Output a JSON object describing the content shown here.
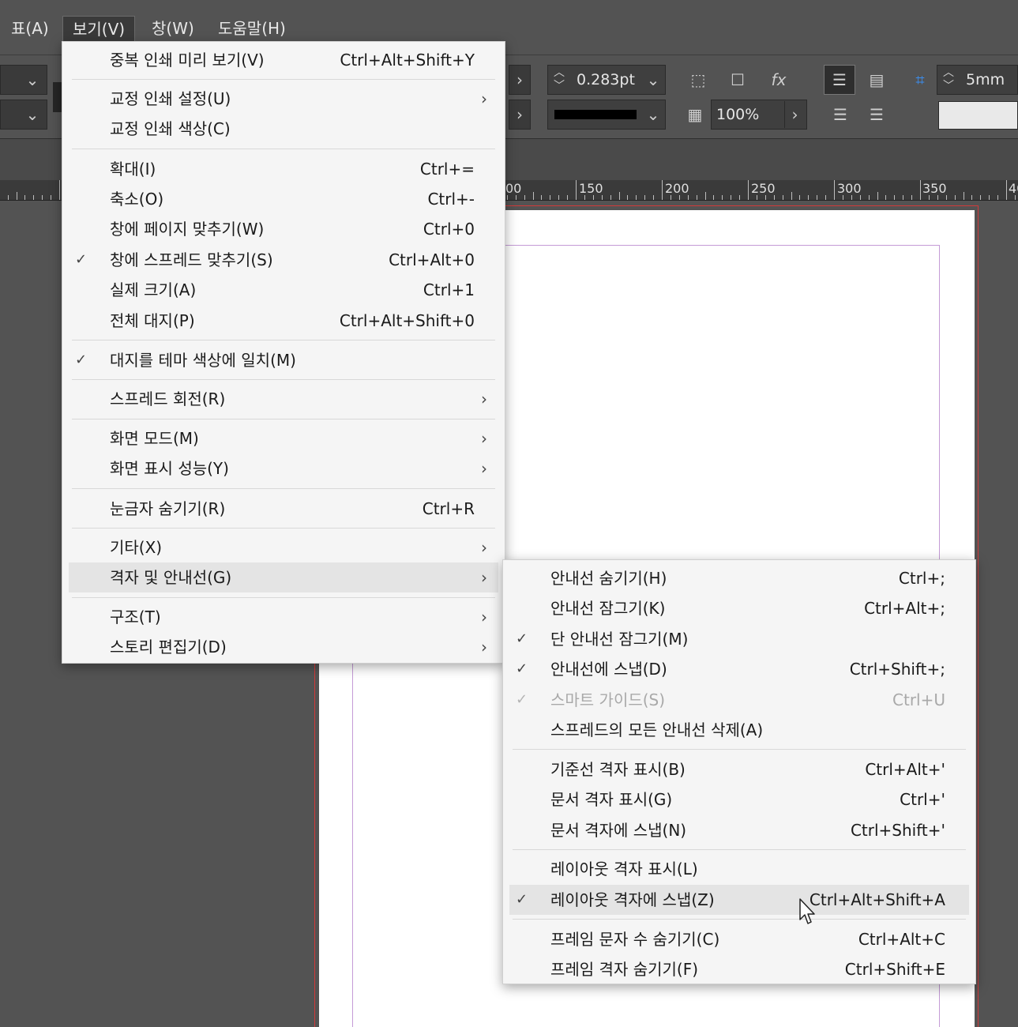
{
  "menubar": {
    "items": [
      {
        "label": "표(A)"
      },
      {
        "label": "보기(V)"
      },
      {
        "label": "창(W)"
      },
      {
        "label": "도움말(H)"
      }
    ]
  },
  "control_panel": {
    "stroke_weight": "0.283pt",
    "opacity": "100%",
    "spacing": "5mm"
  },
  "ruler": {
    "labels": [
      "00",
      "150",
      "200",
      "250",
      "300",
      "350",
      "40"
    ]
  },
  "view_menu": {
    "items": [
      {
        "label": "중복 인쇄 미리 보기(V)",
        "shortcut": "Ctrl+Alt+Shift+Y"
      },
      {
        "label": "교정 인쇄 설정(U)",
        "shortcut": ""
      },
      {
        "label": "교정 인쇄 색상(C)",
        "shortcut": ""
      },
      {
        "label": "확대(I)",
        "shortcut": "Ctrl+="
      },
      {
        "label": "축소(O)",
        "shortcut": "Ctrl+-"
      },
      {
        "label": "창에 페이지 맞추기(W)",
        "shortcut": "Ctrl+0"
      },
      {
        "label": "창에 스프레드 맞추기(S)",
        "shortcut": "Ctrl+Alt+0"
      },
      {
        "label": "실제 크기(A)",
        "shortcut": "Ctrl+1"
      },
      {
        "label": "전체 대지(P)",
        "shortcut": "Ctrl+Alt+Shift+0"
      },
      {
        "label": "대지를 테마 색상에 일치(M)",
        "shortcut": ""
      },
      {
        "label": "스프레드 회전(R)",
        "shortcut": ""
      },
      {
        "label": "화면 모드(M)",
        "shortcut": ""
      },
      {
        "label": "화면 표시 성능(Y)",
        "shortcut": ""
      },
      {
        "label": "눈금자 숨기기(R)",
        "shortcut": "Ctrl+R"
      },
      {
        "label": "기타(X)",
        "shortcut": ""
      },
      {
        "label": "격자 및 안내선(G)",
        "shortcut": ""
      },
      {
        "label": "구조(T)",
        "shortcut": ""
      },
      {
        "label": "스토리 편집기(D)",
        "shortcut": ""
      }
    ]
  },
  "grids_menu": {
    "items": [
      {
        "label": "안내선 숨기기(H)",
        "shortcut": "Ctrl+;"
      },
      {
        "label": "안내선 잠그기(K)",
        "shortcut": "Ctrl+Alt+;"
      },
      {
        "label": "단 안내선 잠그기(M)",
        "shortcut": ""
      },
      {
        "label": "안내선에 스냅(D)",
        "shortcut": "Ctrl+Shift+;"
      },
      {
        "label": "스마트 가이드(S)",
        "shortcut": "Ctrl+U"
      },
      {
        "label": "스프레드의 모든 안내선 삭제(A)",
        "shortcut": ""
      },
      {
        "label": "기준선 격자 표시(B)",
        "shortcut": "Ctrl+Alt+'"
      },
      {
        "label": "문서 격자 표시(G)",
        "shortcut": "Ctrl+'"
      },
      {
        "label": "문서 격자에 스냅(N)",
        "shortcut": "Ctrl+Shift+'"
      },
      {
        "label": "레이아웃 격자 표시(L)",
        "shortcut": ""
      },
      {
        "label": "레이아웃 격자에 스냅(Z)",
        "shortcut": "Ctrl+Alt+Shift+A"
      },
      {
        "label": "프레임 문자 수 숨기기(C)",
        "shortcut": "Ctrl+Alt+C"
      },
      {
        "label": "프레임 격자 숨기기(F)",
        "shortcut": "Ctrl+Shift+E"
      }
    ]
  }
}
